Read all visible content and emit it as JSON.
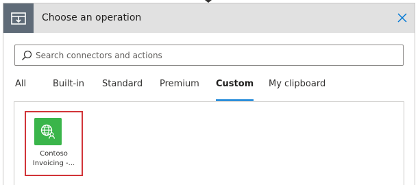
{
  "header": {
    "title": "Choose an operation",
    "icon": "operation-step-icon",
    "close_icon": "close-icon"
  },
  "search": {
    "placeholder": "Search connectors and actions",
    "value": "",
    "icon": "search-icon"
  },
  "tabs": [
    {
      "label": "All",
      "active": false
    },
    {
      "label": "Built-in",
      "active": false
    },
    {
      "label": "Standard",
      "active": false
    },
    {
      "label": "Premium",
      "active": false
    },
    {
      "label": "Custom",
      "active": true
    },
    {
      "label": "My clipboard",
      "active": false
    }
  ],
  "connectors": [
    {
      "name_line1": "Contoso",
      "name_line2": "Invoicing -...",
      "icon": "globe-user-icon",
      "icon_bg": "#3ab54a",
      "highlighted": true
    }
  ],
  "colors": {
    "accent": "#0078d4",
    "highlight": "#d13438",
    "header_bg": "#e1e1e1",
    "header_icon_bg": "#5f6b78"
  }
}
